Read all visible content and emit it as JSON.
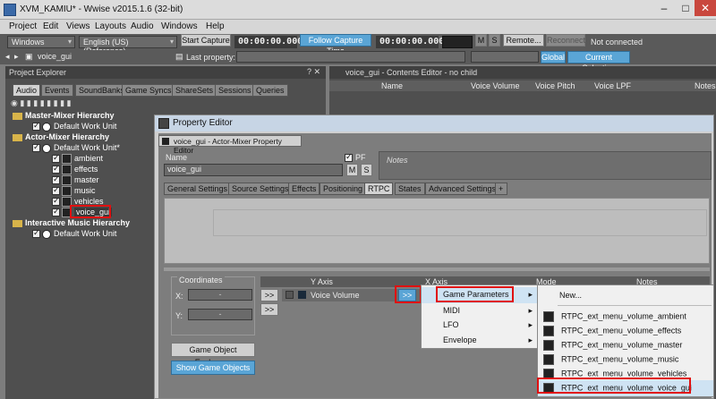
{
  "window": {
    "title": "XVM_KAMIU* - Wwise v2015.1.6 (32-bit)",
    "min": "–",
    "max": "□",
    "close": "✕"
  },
  "menubar": [
    "Project",
    "Edit",
    "Views",
    "Layouts",
    "Audio",
    "Windows",
    "Help"
  ],
  "toolbar": {
    "platform": "Windows",
    "language": "English (US) (Reference)",
    "start_capture": "Start Capture",
    "time1": "00:00:00.000",
    "follow": "Follow Capture Time",
    "time2": "00:00:00.000",
    "m": "M",
    "s": "S",
    "remote": "Remote...",
    "reconnect": "Reconnect",
    "status": "Not connected"
  },
  "toolbar2": {
    "object": "voice_gui",
    "last_property": "Last property:",
    "global": "Global",
    "current_selection": "Current Selection"
  },
  "project_explorer": {
    "title": "Project Explorer",
    "tabs": [
      "Audio",
      "Events",
      "SoundBanks",
      "Game Syncs",
      "ShareSets",
      "Sessions",
      "Queries"
    ],
    "tree": [
      {
        "label": "Master-Mixer Hierarchy",
        "kind": "folder"
      },
      {
        "label": "Default Work Unit",
        "kind": "wu"
      },
      {
        "label": "Actor-Mixer Hierarchy",
        "kind": "folder"
      },
      {
        "label": "Default Work Unit*",
        "kind": "wu"
      },
      {
        "label": "ambient",
        "kind": "obj"
      },
      {
        "label": "effects",
        "kind": "obj"
      },
      {
        "label": "master",
        "kind": "obj"
      },
      {
        "label": "music",
        "kind": "obj"
      },
      {
        "label": "vehicles",
        "kind": "obj"
      },
      {
        "label": "voice_gui",
        "kind": "obj"
      },
      {
        "label": "Interactive Music Hierarchy",
        "kind": "folder"
      },
      {
        "label": "Default Work Unit",
        "kind": "wu"
      }
    ]
  },
  "contents_editor": {
    "title": "voice_gui - Contents Editor - no child",
    "cols": [
      "Name",
      "Voice Volume",
      "Voice Pitch",
      "Voice LPF",
      "Notes"
    ]
  },
  "property_editor": {
    "window_title": "Property Editor",
    "tab_title": "voice_gui - Actor-Mixer Property Editor",
    "name_label": "Name",
    "name_value": "voice_gui",
    "pf": "PF",
    "m": "M",
    "s": "S",
    "notes": "Notes",
    "tabs": [
      "General Settings",
      "Source Settings",
      "Effects",
      "Positioning",
      "RTPC",
      "States",
      "Advanced Settings",
      "+"
    ],
    "coordinates": "Coordinates",
    "x_label": "X:",
    "y_label": "Y:",
    "coord_val": "-",
    "goe_button": "Game Object Explorer...",
    "show_button": "Show Game Objects",
    "rtpc_cols": [
      "Y Axis",
      "X Axis",
      "Mode",
      "Notes"
    ],
    "row_y": "Voice Volume",
    "arrow": ">>"
  },
  "menu1": [
    "Game Parameters",
    "MIDI",
    "LFO",
    "Envelope"
  ],
  "menu2": {
    "new": "New...",
    "items": [
      "RTPC_ext_menu_volume_ambient",
      "RTPC_ext_menu_volume_effects",
      "RTPC_ext_menu_volume_master",
      "RTPC_ext_menu_volume_music",
      "RTPC_ext_menu_volume_vehicles",
      "RTPC_ext_menu_volume_voice_gui"
    ]
  },
  "colors": {
    "highlight": "#e01010",
    "accent": "#5aa5d6"
  }
}
